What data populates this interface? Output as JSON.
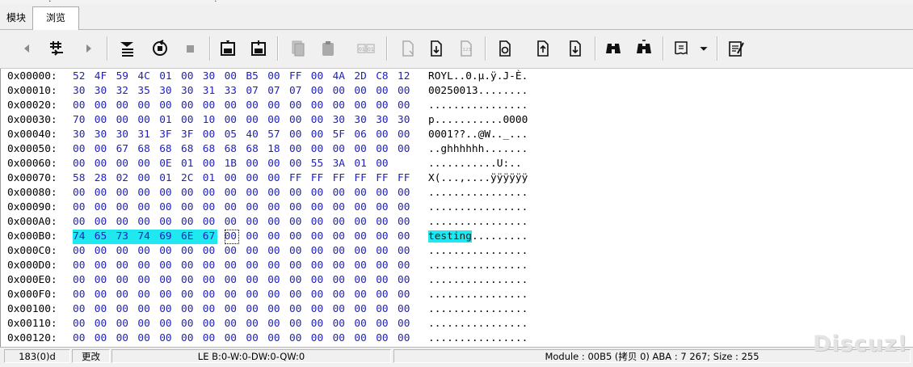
{
  "tabs": [
    {
      "label": "模块"
    },
    {
      "label": "浏览"
    }
  ],
  "toolbar": {
    "buttons": [
      {
        "icon": "arrow-left-icon"
      },
      {
        "icon": "goto-offset-icon"
      },
      {
        "icon": "arrow-right-icon"
      },
      {
        "icon": "download-icon"
      },
      {
        "icon": "refresh-icon"
      },
      {
        "icon": "stop-icon"
      },
      {
        "icon": "save-icon"
      },
      {
        "icon": "save-as-icon"
      },
      {
        "icon": "copy-icon"
      },
      {
        "icon": "paste-icon"
      },
      {
        "icon": "binary-icon"
      },
      {
        "icon": "page-icon"
      },
      {
        "icon": "page-down-icon"
      },
      {
        "icon": "page-123-icon"
      },
      {
        "icon": "page-refresh-icon"
      },
      {
        "icon": "page-up-icon"
      },
      {
        "icon": "page-down-arrow-icon"
      },
      {
        "icon": "binoculars-icon"
      },
      {
        "icon": "binoculars-next-icon"
      },
      {
        "icon": "map-icon"
      },
      {
        "icon": "dropdown-arrow-icon"
      },
      {
        "icon": "edit-notes-icon"
      }
    ]
  },
  "hex": {
    "highlight_color": "#20e8f0",
    "byte_color": "#1f1fbf",
    "rows": [
      {
        "addr": "0x00000:",
        "bytes": [
          "52",
          "4F",
          "59",
          "4C",
          "01",
          "00",
          "30",
          "00",
          "B5",
          "00",
          "FF",
          "00",
          "4A",
          "2D",
          "C8",
          "12"
        ],
        "ascii": "ROYL..0.µ.ÿ.J-È."
      },
      {
        "addr": "0x00010:",
        "bytes": [
          "30",
          "30",
          "32",
          "35",
          "30",
          "30",
          "31",
          "33",
          "07",
          "07",
          "07",
          "00",
          "00",
          "00",
          "00",
          "00"
        ],
        "ascii": "00250013........"
      },
      {
        "addr": "0x00020:",
        "bytes": [
          "00",
          "00",
          "00",
          "00",
          "00",
          "00",
          "00",
          "00",
          "00",
          "00",
          "00",
          "00",
          "00",
          "00",
          "00",
          "00"
        ],
        "ascii": "................"
      },
      {
        "addr": "0x00030:",
        "bytes": [
          "70",
          "00",
          "00",
          "00",
          "01",
          "00",
          "10",
          "00",
          "00",
          "00",
          "00",
          "00",
          "30",
          "30",
          "30",
          "30"
        ],
        "ascii": "p...........0000"
      },
      {
        "addr": "0x00040:",
        "bytes": [
          "30",
          "30",
          "30",
          "31",
          "3F",
          "3F",
          "00",
          "05",
          "40",
          "57",
          "00",
          "00",
          "5F",
          "06",
          "00",
          "00"
        ],
        "ascii": "0001??..@W.._..."
      },
      {
        "addr": "0x00050:",
        "bytes": [
          "00",
          "00",
          "67",
          "68",
          "68",
          "68",
          "68",
          "68",
          "68",
          "18",
          "00",
          "00",
          "00",
          "00",
          "00",
          "00"
        ],
        "ascii": "..ghhhhhh......."
      },
      {
        "addr": "0x00060:",
        "bytes": [
          "00",
          "00",
          "00",
          "00",
          "0E",
          "01",
          "00",
          "1B",
          "00",
          "00",
          "00",
          "55",
          "3A",
          "01",
          "00"
        ],
        "ascii": "...........U:.."
      },
      {
        "addr": "0x00070:",
        "bytes": [
          "58",
          "28",
          "02",
          "00",
          "01",
          "2C",
          "01",
          "00",
          "00",
          "00",
          "FF",
          "FF",
          "FF",
          "FF",
          "FF",
          "FF"
        ],
        "ascii": "X(...,....ÿÿÿÿÿÿ"
      },
      {
        "addr": "0x00080:",
        "bytes": [
          "00",
          "00",
          "00",
          "00",
          "00",
          "00",
          "00",
          "00",
          "00",
          "00",
          "00",
          "00",
          "00",
          "00",
          "00",
          "00"
        ],
        "ascii": "................"
      },
      {
        "addr": "0x00090:",
        "bytes": [
          "00",
          "00",
          "00",
          "00",
          "00",
          "00",
          "00",
          "00",
          "00",
          "00",
          "00",
          "00",
          "00",
          "00",
          "00",
          "00"
        ],
        "ascii": "................"
      },
      {
        "addr": "0x000A0:",
        "bytes": [
          "00",
          "00",
          "00",
          "00",
          "00",
          "00",
          "00",
          "00",
          "00",
          "00",
          "00",
          "00",
          "00",
          "00",
          "00",
          "00"
        ],
        "ascii": "................"
      },
      {
        "addr": "0x000B0:",
        "bytes": [
          "74",
          "65",
          "73",
          "74",
          "69",
          "6E",
          "67",
          "00",
          "00",
          "00",
          "00",
          "00",
          "00",
          "00",
          "00",
          "00"
        ],
        "ascii_hl": "testing",
        "ascii": ".........",
        "hl_count": 7,
        "cursor_index": 7
      },
      {
        "addr": "0x000C0:",
        "bytes": [
          "00",
          "00",
          "00",
          "00",
          "00",
          "00",
          "00",
          "00",
          "00",
          "00",
          "00",
          "00",
          "00",
          "00",
          "00",
          "00"
        ],
        "ascii": "................"
      },
      {
        "addr": "0x000D0:",
        "bytes": [
          "00",
          "00",
          "00",
          "00",
          "00",
          "00",
          "00",
          "00",
          "00",
          "00",
          "00",
          "00",
          "00",
          "00",
          "00",
          "00"
        ],
        "ascii": "................"
      },
      {
        "addr": "0x000E0:",
        "bytes": [
          "00",
          "00",
          "00",
          "00",
          "00",
          "00",
          "00",
          "00",
          "00",
          "00",
          "00",
          "00",
          "00",
          "00",
          "00",
          "00"
        ],
        "ascii": "................"
      },
      {
        "addr": "0x000F0:",
        "bytes": [
          "00",
          "00",
          "00",
          "00",
          "00",
          "00",
          "00",
          "00",
          "00",
          "00",
          "00",
          "00",
          "00",
          "00",
          "00",
          "00"
        ],
        "ascii": "................"
      },
      {
        "addr": "0x00100:",
        "bytes": [
          "00",
          "00",
          "00",
          "00",
          "00",
          "00",
          "00",
          "00",
          "00",
          "00",
          "00",
          "00",
          "00",
          "00",
          "00",
          "00"
        ],
        "ascii": "................"
      },
      {
        "addr": "0x00110:",
        "bytes": [
          "00",
          "00",
          "00",
          "00",
          "00",
          "00",
          "00",
          "00",
          "00",
          "00",
          "00",
          "00",
          "00",
          "00",
          "00",
          "00"
        ],
        "ascii": "................"
      },
      {
        "addr": "0x00120:",
        "bytes": [
          "00",
          "00",
          "00",
          "00",
          "00",
          "00",
          "00",
          "00",
          "00",
          "00",
          "00",
          "00",
          "00",
          "00",
          "00",
          "00"
        ],
        "ascii": "................"
      }
    ]
  },
  "status": {
    "position": "183(0)d",
    "mode": "更改",
    "value_info": "LE B:0-W:0-DW:0-QW:0",
    "module_info": "Module : 00B5 (拷贝 0) ABA : 7 267; Size : 255"
  },
  "watermark": {
    "text": "Discuz!"
  }
}
